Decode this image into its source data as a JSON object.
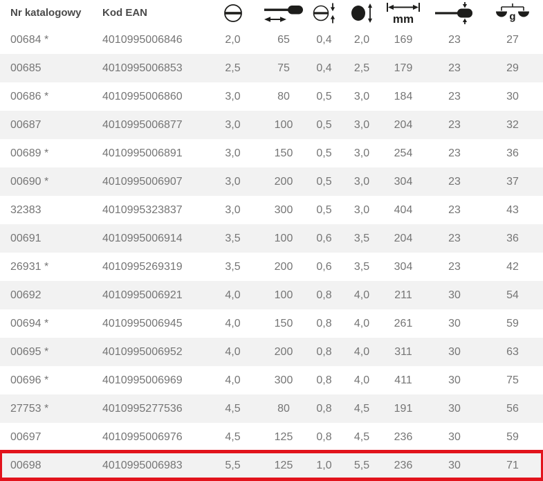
{
  "table": {
    "columns": [
      {
        "label": "Nr katalogowy"
      },
      {
        "label": "Kod EAN"
      },
      {
        "icon": "slot-width-icon"
      },
      {
        "icon": "blade-length-icon"
      },
      {
        "icon": "slot-thickness-icon"
      },
      {
        "icon": "tip-diameter-icon"
      },
      {
        "icon": "overall-length-icon",
        "unit": "mm"
      },
      {
        "icon": "handle-diameter-icon"
      },
      {
        "icon": "weight-icon",
        "unit": "g"
      }
    ],
    "rows": [
      {
        "nr": "00684 *",
        "ean": "4010995006846",
        "values": [
          "2,0",
          "65",
          "0,4",
          "2,0",
          "169",
          "23",
          "27"
        ]
      },
      {
        "nr": "00685",
        "ean": "4010995006853",
        "values": [
          "2,5",
          "75",
          "0,4",
          "2,5",
          "179",
          "23",
          "29"
        ]
      },
      {
        "nr": "00686 *",
        "ean": "4010995006860",
        "values": [
          "3,0",
          "80",
          "0,5",
          "3,0",
          "184",
          "23",
          "30"
        ]
      },
      {
        "nr": "00687",
        "ean": "4010995006877",
        "values": [
          "3,0",
          "100",
          "0,5",
          "3,0",
          "204",
          "23",
          "32"
        ]
      },
      {
        "nr": "00689 *",
        "ean": "4010995006891",
        "values": [
          "3,0",
          "150",
          "0,5",
          "3,0",
          "254",
          "23",
          "36"
        ]
      },
      {
        "nr": "00690 *",
        "ean": "4010995006907",
        "values": [
          "3,0",
          "200",
          "0,5",
          "3,0",
          "304",
          "23",
          "37"
        ]
      },
      {
        "nr": "32383",
        "ean": "4010995323837",
        "values": [
          "3,0",
          "300",
          "0,5",
          "3,0",
          "404",
          "23",
          "43"
        ]
      },
      {
        "nr": "00691",
        "ean": "4010995006914",
        "values": [
          "3,5",
          "100",
          "0,6",
          "3,5",
          "204",
          "23",
          "36"
        ]
      },
      {
        "nr": "26931 *",
        "ean": "4010995269319",
        "values": [
          "3,5",
          "200",
          "0,6",
          "3,5",
          "304",
          "23",
          "42"
        ]
      },
      {
        "nr": "00692",
        "ean": "4010995006921",
        "values": [
          "4,0",
          "100",
          "0,8",
          "4,0",
          "211",
          "30",
          "54"
        ]
      },
      {
        "nr": "00694 *",
        "ean": "4010995006945",
        "values": [
          "4,0",
          "150",
          "0,8",
          "4,0",
          "261",
          "30",
          "59"
        ]
      },
      {
        "nr": "00695 *",
        "ean": "4010995006952",
        "values": [
          "4,0",
          "200",
          "0,8",
          "4,0",
          "311",
          "30",
          "63"
        ]
      },
      {
        "nr": "00696 *",
        "ean": "4010995006969",
        "values": [
          "4,0",
          "300",
          "0,8",
          "4,0",
          "411",
          "30",
          "75"
        ]
      },
      {
        "nr": "27753 *",
        "ean": "4010995277536",
        "values": [
          "4,5",
          "80",
          "0,8",
          "4,5",
          "191",
          "30",
          "56"
        ]
      },
      {
        "nr": "00697",
        "ean": "4010995006976",
        "values": [
          "4,5",
          "125",
          "0,8",
          "4,5",
          "236",
          "30",
          "59"
        ]
      },
      {
        "nr": "00698",
        "ean": "4010995006983",
        "values": [
          "5,5",
          "125",
          "1,0",
          "5,5",
          "236",
          "30",
          "71"
        ],
        "highlighted": true
      }
    ],
    "highlighted_row": "00698"
  },
  "colors": {
    "highlight_border": "#e2131c",
    "row_stripe": "#f2f2f2",
    "body_text": "#757575",
    "header_text": "#4a4a4a",
    "icon": "#1d1d1b"
  }
}
